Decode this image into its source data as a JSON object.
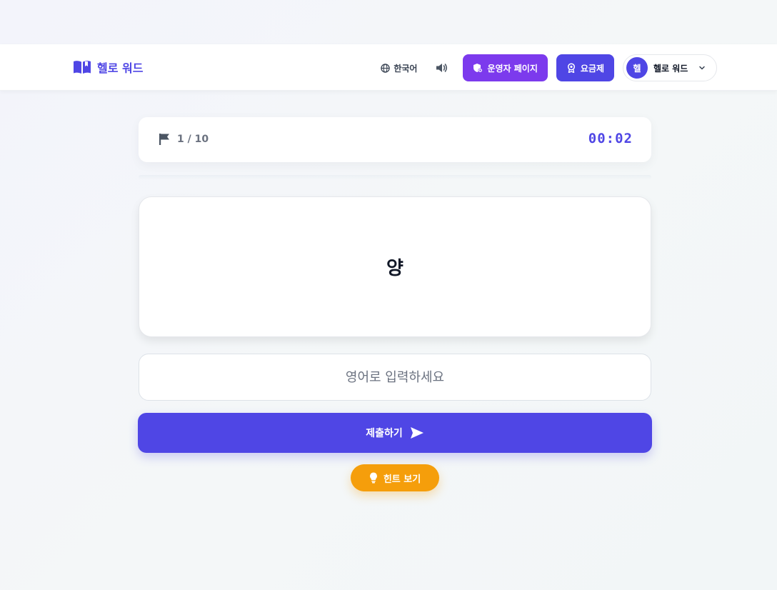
{
  "header": {
    "logo_text": "헬로 워드",
    "language_label": "한국어",
    "admin_button": "운영자 페이지",
    "pricing_button": "요금제",
    "user": {
      "avatar_initial": "헬",
      "name": "헬로 워드"
    }
  },
  "quiz": {
    "progress": "1 / 10",
    "timer": "00:02",
    "word": "양",
    "answer_placeholder": "영어로 입력하세요",
    "answer_value": "",
    "submit_label": "제출하기",
    "hint_label": "힌트 보기"
  },
  "colors": {
    "primary": "#4f46e5",
    "admin": "#7c3aed",
    "hint": "#f59e0b"
  }
}
